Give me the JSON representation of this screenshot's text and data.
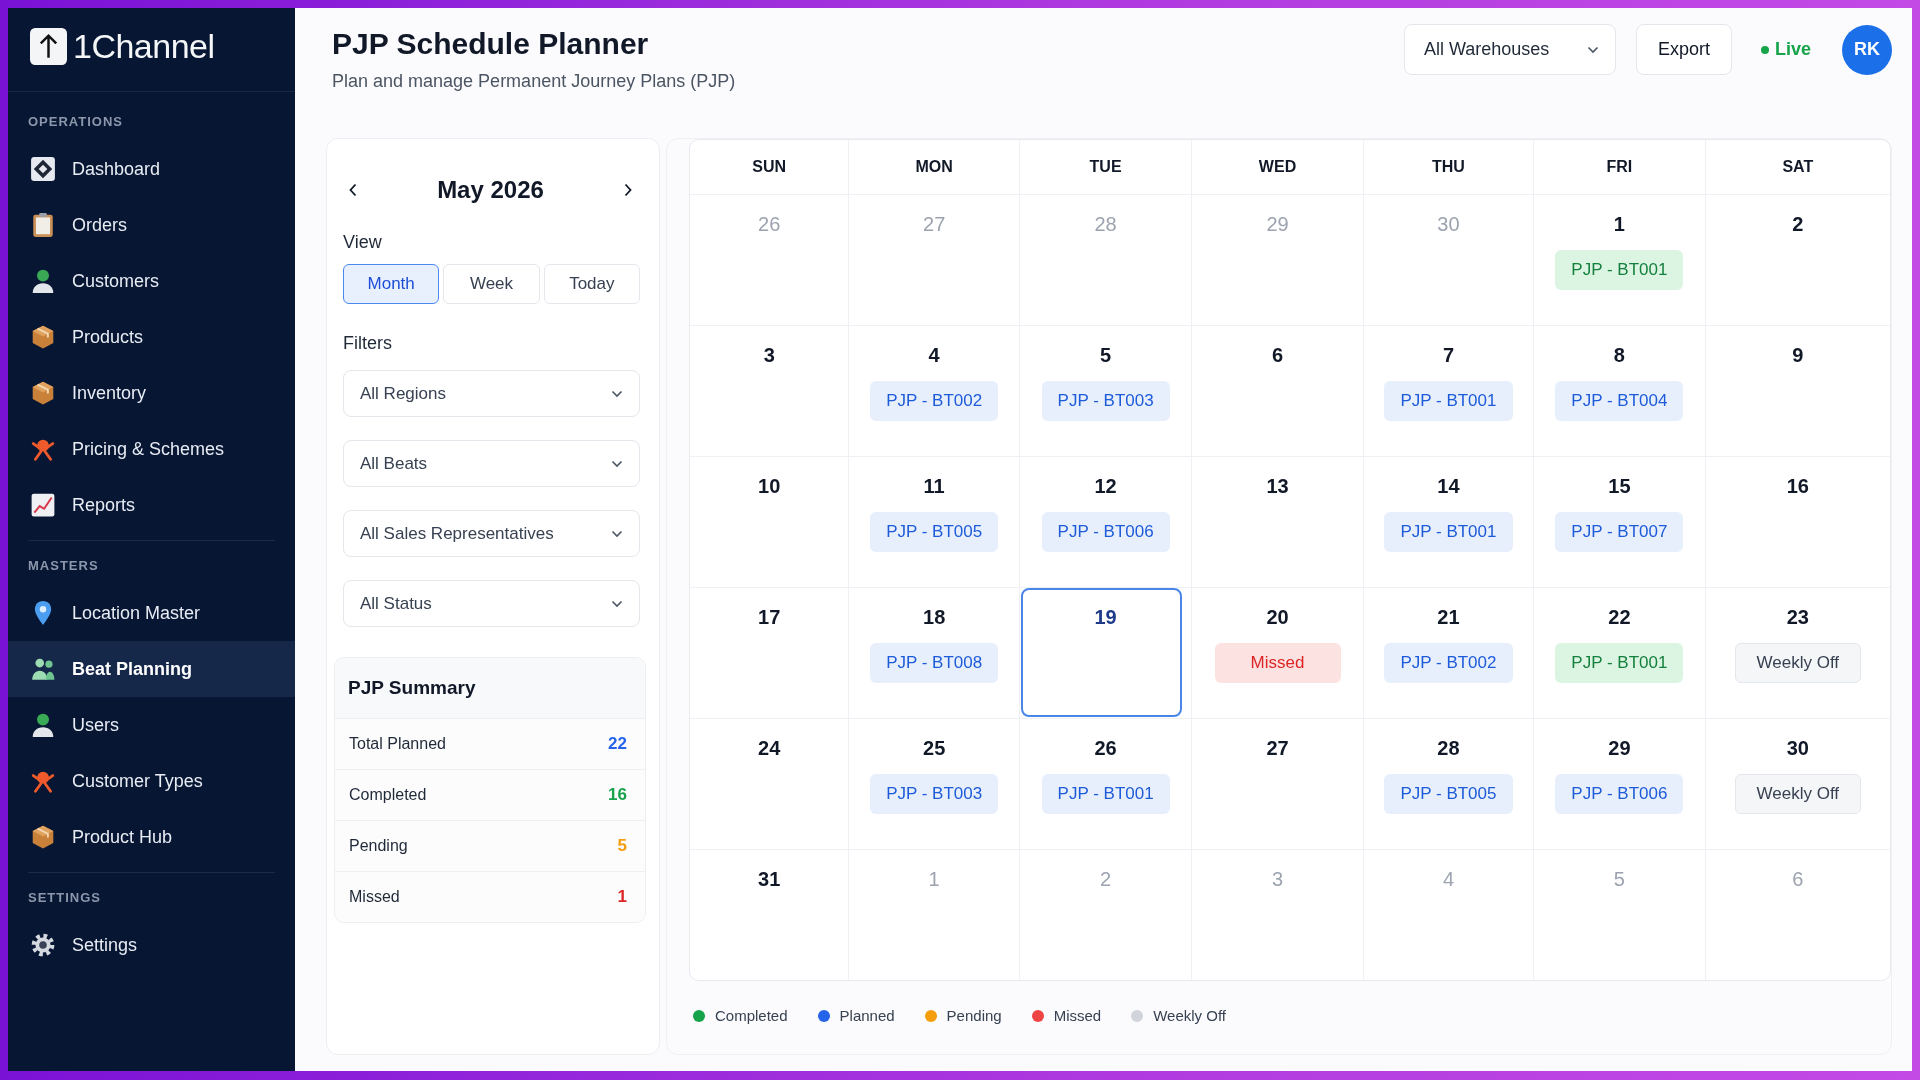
{
  "sidebar": {
    "brand": "1Channel",
    "sections": [
      {
        "heading": "OPERATIONS",
        "items": [
          {
            "label": "Dashboard",
            "selected": false
          },
          {
            "label": "Orders",
            "selected": false
          },
          {
            "label": "Customers",
            "selected": false
          },
          {
            "label": "Products",
            "selected": false
          },
          {
            "label": "Inventory",
            "selected": false
          },
          {
            "label": "Pricing & Schemes",
            "selected": false
          },
          {
            "label": "Reports",
            "selected": false
          }
        ]
      },
      {
        "heading": "MASTERS",
        "items": [
          {
            "label": "Location Master",
            "selected": false
          },
          {
            "label": "Beat Planning",
            "selected": true
          },
          {
            "label": "Users",
            "selected": false
          },
          {
            "label": "Customer Types",
            "selected": false
          },
          {
            "label": "Product Hub",
            "selected": false
          }
        ]
      },
      {
        "heading": "SETTINGS",
        "items": [
          {
            "label": "Settings",
            "selected": false
          }
        ]
      }
    ]
  },
  "header": {
    "title": "PJP Schedule Planner",
    "subtitle": "Plan and manage Permanent Journey Plans (PJP)",
    "warehouse_select": "All Warehouses",
    "export_button": "Export",
    "live_status": "Live",
    "avatar": "RK"
  },
  "planner_panel": {
    "month_title": "May 2026",
    "view_label": "View",
    "view_tabs": [
      {
        "label": "Month",
        "selected": true
      },
      {
        "label": "Week",
        "selected": false
      },
      {
        "label": "Today",
        "selected": false
      }
    ],
    "filters_label": "Filters",
    "filters": [
      "All Regions",
      "All Beats",
      "All Sales Representatives",
      "All Status"
    ],
    "summary": {
      "title": "PJP Summary",
      "rows": [
        {
          "label": "Total Planned",
          "value": "22",
          "color": "#2563eb"
        },
        {
          "label": "Completed",
          "value": "16",
          "color": "#16a34a"
        },
        {
          "label": "Pending",
          "value": "5",
          "color": "#f59e0b"
        },
        {
          "label": "Missed",
          "value": "1",
          "color": "#dc2626"
        }
      ]
    }
  },
  "calendar": {
    "weekdays": [
      "SUN",
      "MON",
      "TUE",
      "WED",
      "THU",
      "FRI",
      "SAT"
    ],
    "weeks": [
      {
        "days": [
          {
            "day": "26",
            "muted": true,
            "today": false
          },
          {
            "day": "27",
            "muted": true,
            "today": false
          },
          {
            "day": "28",
            "muted": true,
            "today": false
          },
          {
            "day": "29",
            "muted": true,
            "today": false
          },
          {
            "day": "30",
            "muted": true,
            "today": false
          },
          {
            "day": "1",
            "muted": false,
            "today": false,
            "event": {
              "label": "PJP - BT001",
              "kind": "completed"
            }
          },
          {
            "day": "2",
            "muted": false,
            "today": false
          }
        ]
      },
      {
        "days": [
          {
            "day": "3",
            "muted": false,
            "today": false
          },
          {
            "day": "4",
            "muted": false,
            "today": false,
            "event": {
              "label": "PJP - BT002",
              "kind": "planned"
            }
          },
          {
            "day": "5",
            "muted": false,
            "today": false,
            "event": {
              "label": "PJP - BT003",
              "kind": "planned"
            }
          },
          {
            "day": "6",
            "muted": false,
            "today": false
          },
          {
            "day": "7",
            "muted": false,
            "today": false,
            "event": {
              "label": "PJP - BT001",
              "kind": "planned"
            }
          },
          {
            "day": "8",
            "muted": false,
            "today": false,
            "event": {
              "label": "PJP - BT004",
              "kind": "planned"
            }
          },
          {
            "day": "9",
            "muted": false,
            "today": false
          }
        ]
      },
      {
        "days": [
          {
            "day": "10",
            "muted": false,
            "today": false
          },
          {
            "day": "11",
            "muted": false,
            "today": false,
            "event": {
              "label": "PJP - BT005",
              "kind": "planned"
            }
          },
          {
            "day": "12",
            "muted": false,
            "today": false,
            "event": {
              "label": "PJP - BT006",
              "kind": "planned"
            }
          },
          {
            "day": "13",
            "muted": false,
            "today": false
          },
          {
            "day": "14",
            "muted": false,
            "today": false,
            "event": {
              "label": "PJP - BT001",
              "kind": "planned"
            }
          },
          {
            "day": "15",
            "muted": false,
            "today": false,
            "event": {
              "label": "PJP - BT007",
              "kind": "planned"
            }
          },
          {
            "day": "16",
            "muted": false,
            "today": false
          }
        ]
      },
      {
        "days": [
          {
            "day": "17",
            "muted": false,
            "today": false
          },
          {
            "day": "18",
            "muted": false,
            "today": false,
            "event": {
              "label": "PJP - BT008",
              "kind": "planned"
            }
          },
          {
            "day": "19",
            "muted": false,
            "today": true
          },
          {
            "day": "20",
            "muted": false,
            "today": false,
            "event": {
              "label": "Missed",
              "kind": "missed"
            }
          },
          {
            "day": "21",
            "muted": false,
            "today": false,
            "event": {
              "label": "PJP - BT002",
              "kind": "planned"
            }
          },
          {
            "day": "22",
            "muted": false,
            "today": false,
            "event": {
              "label": "PJP - BT001",
              "kind": "completed"
            }
          },
          {
            "day": "23",
            "muted": false,
            "today": false,
            "event": {
              "label": "Weekly Off",
              "kind": "off"
            }
          }
        ]
      },
      {
        "days": [
          {
            "day": "24",
            "muted": false,
            "today": false
          },
          {
            "day": "25",
            "muted": false,
            "today": false,
            "event": {
              "label": "PJP - BT003",
              "kind": "planned"
            }
          },
          {
            "day": "26",
            "muted": false,
            "today": false,
            "event": {
              "label": "PJP - BT001",
              "kind": "planned"
            }
          },
          {
            "day": "27",
            "muted": false,
            "today": false
          },
          {
            "day": "28",
            "muted": false,
            "today": false,
            "event": {
              "label": "PJP - BT005",
              "kind": "planned"
            }
          },
          {
            "day": "29",
            "muted": false,
            "today": false,
            "event": {
              "label": "PJP - BT006",
              "kind": "planned"
            }
          },
          {
            "day": "30",
            "muted": false,
            "today": false,
            "event": {
              "label": "Weekly Off",
              "kind": "off"
            }
          }
        ]
      },
      {
        "days": [
          {
            "day": "31",
            "muted": false,
            "today": false
          },
          {
            "day": "1",
            "muted": true,
            "today": false
          },
          {
            "day": "2",
            "muted": true,
            "today": false
          },
          {
            "day": "3",
            "muted": true,
            "today": false
          },
          {
            "day": "4",
            "muted": true,
            "today": false
          },
          {
            "day": "5",
            "muted": true,
            "today": false
          },
          {
            "day": "6",
            "muted": true,
            "today": false
          }
        ]
      }
    ]
  },
  "legend": [
    {
      "label": "Completed",
      "color": "#16a34a"
    },
    {
      "label": "Planned",
      "color": "#2563eb"
    },
    {
      "label": "Pending",
      "color": "#f59e0b"
    },
    {
      "label": "Missed",
      "color": "#ef4444"
    },
    {
      "label": "Weekly Off",
      "color": "#d1d5db"
    }
  ]
}
